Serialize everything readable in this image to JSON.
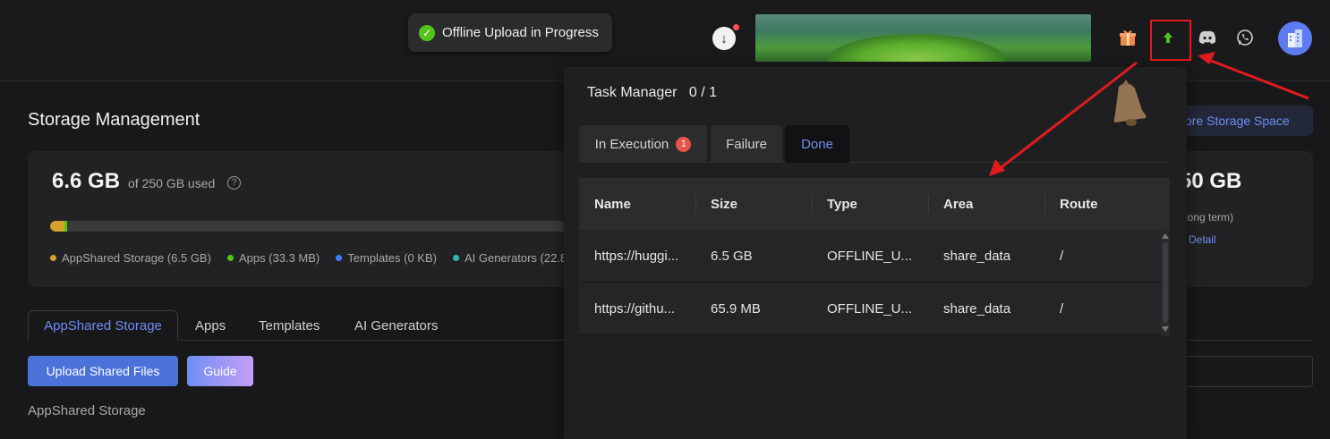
{
  "toast": {
    "message": "Offline Upload in Progress"
  },
  "header": {
    "icons": [
      "download-icon",
      "gift-icon",
      "upload-icon",
      "discord-icon",
      "whatsapp-icon",
      "avatar"
    ]
  },
  "page": {
    "title": "Storage Management",
    "right_button": "ore Storage Space",
    "right_size": "50 GB",
    "right_term": "Long term)",
    "right_detail": "Detail"
  },
  "storage": {
    "used_value": "6.6 GB",
    "used_suffix": "of 250 GB used",
    "usage_fraction": 0.0264,
    "legend": [
      {
        "label": "AppShared Storage (6.5 GB)",
        "color": "#d4a12a"
      },
      {
        "label": "Apps (33.3 MB)",
        "color": "#52c41a"
      },
      {
        "label": "Templates (0 KB)",
        "color": "#3b82f6"
      },
      {
        "label": "AI Generators (22.8",
        "color": "#2fb8b0"
      }
    ]
  },
  "subtabs": [
    "AppShared Storage",
    "Apps",
    "Templates",
    "AI Generators"
  ],
  "actions": {
    "upload": "Upload Shared Files",
    "guide": "Guide"
  },
  "section_label": "AppShared Storage",
  "task_manager": {
    "title": "Task Manager",
    "count": "0 / 1",
    "tabs": [
      {
        "label": "In Execution",
        "badge": "1"
      },
      {
        "label": "Failure"
      },
      {
        "label": "Done"
      }
    ],
    "columns": [
      "Name",
      "Size",
      "Type",
      "Area",
      "Route"
    ],
    "rows": [
      [
        "https://huggi...",
        "6.5 GB",
        "OFFLINE_U...",
        "share_data",
        "/"
      ],
      [
        "https://githu...",
        "65.9 MB",
        "OFFLINE_U...",
        "share_data",
        "/"
      ]
    ]
  },
  "colors": {
    "accent": "#6f8df5",
    "annotation": "#e01b1b",
    "success": "#52c41a"
  }
}
